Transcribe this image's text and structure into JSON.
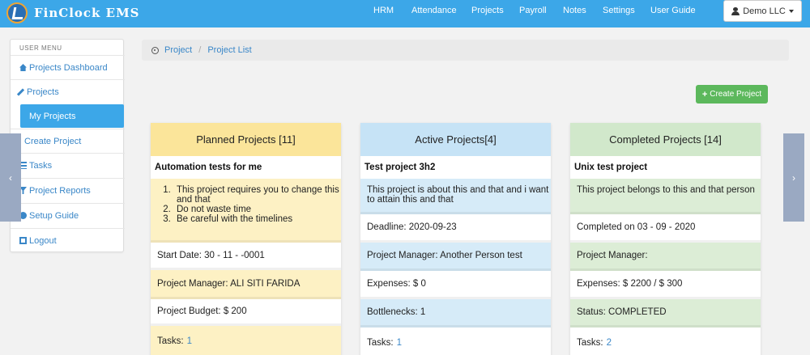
{
  "navbar": {
    "brand": "FinClock EMS",
    "links": [
      "HRM",
      "Attendance",
      "Projects",
      "Payroll",
      "Notes",
      "Settings",
      "User Guide"
    ],
    "user_label": "Demo LLC"
  },
  "sidebar": {
    "heading": "USER MENU",
    "items": [
      {
        "label": "Projects Dashboard",
        "icon": "home-icon"
      },
      {
        "label": "Projects",
        "icon": "wrench-icon"
      },
      {
        "label": "My Projects",
        "active": true
      },
      {
        "label": "Create Project"
      },
      {
        "label": "Tasks",
        "icon": "list-icon"
      },
      {
        "label": "Project Reports",
        "icon": "filter-icon"
      },
      {
        "label": "Setup Guide",
        "icon": "info-icon"
      },
      {
        "label": "Logout",
        "icon": "logout-icon"
      }
    ]
  },
  "breadcrumb": {
    "items": [
      "Project",
      "Project List"
    ]
  },
  "create_button": "Create Project",
  "columns": [
    {
      "header": "Planned Projects [11]",
      "project_name": "Automation tests for me",
      "description_list": [
        "This project requires you to change this and that",
        "Do not waste time",
        "Be careful with the timelines"
      ],
      "start_date": "Start Date: 30 - 11 - -0001",
      "manager": "Project Manager: ALI SITI FARIDA",
      "budget": "Project Budget: $ 200",
      "tasks_label": "Tasks:",
      "tasks_count": "1"
    },
    {
      "header": "Active Projects[4]",
      "project_name": "Test project 3h2",
      "description": "This project is about this and that and i want to attain this and that",
      "deadline": "Deadline: 2020-09-23",
      "manager": "Project Manager: Another Person test",
      "expenses": "Expenses: $ 0",
      "bottlenecks": "Bottlenecks: 1",
      "tasks_label": "Tasks:",
      "tasks_count": "1"
    },
    {
      "header": "Completed Projects [14]",
      "project_name": "Unix test project",
      "description": "This project belongs to this and that person",
      "completed": "Completed on 03 - 09 - 2020",
      "manager": "Project Manager:",
      "expenses": "Expenses: $ 2200 / $ 300",
      "status": "Status: COMPLETED",
      "tasks_label": "Tasks:",
      "tasks_count": "2"
    }
  ],
  "colors": {
    "navbar": "#3ca7e8",
    "planned_header": "#fbe59a",
    "planned_tint": "#fdf1c4",
    "active_header": "#c6e3f6",
    "active_tint": "#d6ebf8",
    "completed_header": "#d1e8cb",
    "completed_tint": "#dcedd6",
    "success": "#5cb85c"
  }
}
